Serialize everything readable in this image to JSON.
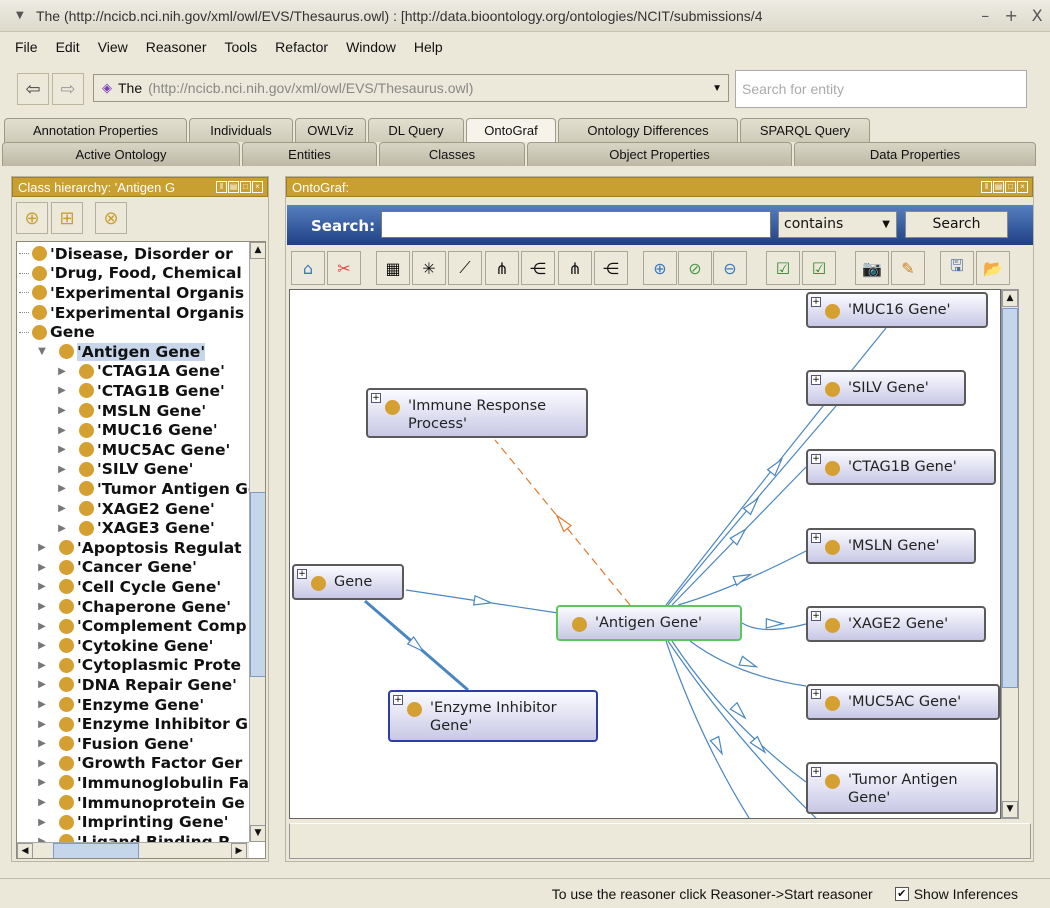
{
  "window": {
    "title": "The (http://ncicb.nci.nih.gov/xml/owl/EVS/Thesaurus.owl)  : [http://data.bioontology.org/ontologies/NCIT/submissions/4",
    "controls": [
      "–",
      "+",
      "X"
    ]
  },
  "menu": [
    "File",
    "Edit",
    "View",
    "Reasoner",
    "Tools",
    "Refactor",
    "Window",
    "Help"
  ],
  "nav": {
    "ontology_name": "The",
    "ontology_iri": "(http://ncicb.nci.nih.gov/xml/owl/EVS/Thesaurus.owl)",
    "search_placeholder": "Search for entity"
  },
  "tabs_row1": [
    {
      "label": "Annotation Properties"
    },
    {
      "label": "Individuals"
    },
    {
      "label": "OWLViz"
    },
    {
      "label": "DL Query"
    },
    {
      "label": "OntoGraf",
      "active": true
    },
    {
      "label": "Ontology Differences"
    },
    {
      "label": "SPARQL Query"
    }
  ],
  "tabs_row2": [
    {
      "label": "Active Ontology"
    },
    {
      "label": "Entities"
    },
    {
      "label": "Classes"
    },
    {
      "label": "Object Properties"
    },
    {
      "label": "Data Properties"
    }
  ],
  "left_panel": {
    "title": "Class hierarchy: 'Antigen G",
    "tree": [
      {
        "label": "'Disease, Disorder or",
        "level": 0,
        "expander": "none"
      },
      {
        "label": "'Drug, Food, Chemical",
        "level": 0,
        "expander": "none"
      },
      {
        "label": "'Experimental Organis",
        "level": 0,
        "expander": "none"
      },
      {
        "label": "'Experimental Organis",
        "level": 0,
        "expander": "none"
      },
      {
        "label": "Gene",
        "level": 0,
        "expander": "none"
      },
      {
        "label": "'Antigen Gene'",
        "level": 1,
        "expander": "expanded",
        "selected": true
      },
      {
        "label": "'CTAG1A Gene'",
        "level": 2,
        "expander": "collapsed"
      },
      {
        "label": "'CTAG1B Gene'",
        "level": 2,
        "expander": "collapsed"
      },
      {
        "label": "'MSLN Gene'",
        "level": 2,
        "expander": "collapsed"
      },
      {
        "label": "'MUC16 Gene'",
        "level": 2,
        "expander": "collapsed"
      },
      {
        "label": "'MUC5AC Gene'",
        "level": 2,
        "expander": "collapsed"
      },
      {
        "label": "'SILV Gene'",
        "level": 2,
        "expander": "collapsed"
      },
      {
        "label": "'Tumor Antigen Gene'",
        "level": 2,
        "expander": "collapsed"
      },
      {
        "label": "'XAGE2 Gene'",
        "level": 2,
        "expander": "collapsed"
      },
      {
        "label": "'XAGE3 Gene'",
        "level": 2,
        "expander": "collapsed"
      },
      {
        "label": "'Apoptosis Regulat",
        "level": 1,
        "expander": "collapsed"
      },
      {
        "label": "'Cancer Gene'",
        "level": 1,
        "expander": "collapsed"
      },
      {
        "label": "'Cell Cycle Gene'",
        "level": 1,
        "expander": "collapsed"
      },
      {
        "label": "'Chaperone Gene'",
        "level": 1,
        "expander": "collapsed"
      },
      {
        "label": "'Complement Comp",
        "level": 1,
        "expander": "collapsed"
      },
      {
        "label": "'Cytokine Gene'",
        "level": 1,
        "expander": "collapsed"
      },
      {
        "label": "'Cytoplasmic Prote",
        "level": 1,
        "expander": "collapsed"
      },
      {
        "label": "'DNA Repair Gene'",
        "level": 1,
        "expander": "collapsed"
      },
      {
        "label": "'Enzyme Gene'",
        "level": 1,
        "expander": "collapsed"
      },
      {
        "label": "'Enzyme Inhibitor G",
        "level": 1,
        "expander": "collapsed"
      },
      {
        "label": "'Fusion Gene'",
        "level": 1,
        "expander": "collapsed"
      },
      {
        "label": "'Growth Factor Ger",
        "level": 1,
        "expander": "collapsed"
      },
      {
        "label": "'Immunoglobulin Fa",
        "level": 1,
        "expander": "collapsed"
      },
      {
        "label": "'Immunoprotein Ge",
        "level": 1,
        "expander": "collapsed"
      },
      {
        "label": "'Imprinting Gene'",
        "level": 1,
        "expander": "collapsed"
      },
      {
        "label": "'Ligand Binding P",
        "level": 1,
        "expander": "collapsed"
      }
    ]
  },
  "right_panel": {
    "title": "OntoGraf:",
    "search_label": "Search:",
    "search_value": "",
    "search_mode": "contains",
    "search_button": "Search",
    "toolbar_icons": [
      "home-icon",
      "remove-unselected-icon",
      "grid-layout-icon",
      "radial-layout-icon",
      "spring-layout-icon",
      "vertical-tree-icon",
      "horizontal-tree-icon",
      "vertical-directed-tree-icon",
      "horizontal-directed-tree-icon",
      "zoom-in-icon",
      "zoom-reset-icon",
      "zoom-out-icon",
      "node-filter-icon",
      "arc-filter-icon",
      "camera-icon",
      "edit-icon",
      "save-icon",
      "open-folder-icon"
    ],
    "graph": {
      "nodes": [
        {
          "id": "immune",
          "label": "'Immune Response Process'",
          "state": "normal"
        },
        {
          "id": "gene",
          "label": "Gene",
          "state": "normal"
        },
        {
          "id": "enzinh",
          "label": "'Enzyme Inhibitor Gene'",
          "state": "highlighted"
        },
        {
          "id": "antigen",
          "label": "'Antigen Gene'",
          "state": "selected"
        },
        {
          "id": "muc16",
          "label": "'MUC16 Gene'",
          "state": "normal"
        },
        {
          "id": "silv",
          "label": "'SILV Gene'",
          "state": "normal"
        },
        {
          "id": "ctag1b",
          "label": "'CTAG1B Gene'",
          "state": "normal"
        },
        {
          "id": "msln",
          "label": "'MSLN Gene'",
          "state": "normal"
        },
        {
          "id": "xage2",
          "label": "'XAGE2 Gene'",
          "state": "normal"
        },
        {
          "id": "muc5ac",
          "label": "'MUC5AC Gene'",
          "state": "normal"
        },
        {
          "id": "tumor",
          "label": "'Tumor Antigen Gene'",
          "state": "normal"
        }
      ],
      "edges": [
        {
          "from": "gene",
          "to": "antigen",
          "type": "subclass"
        },
        {
          "from": "gene",
          "to": "enzinh",
          "type": "subclass-bold"
        },
        {
          "from": "antigen",
          "to": "immune",
          "type": "object-property"
        },
        {
          "from": "antigen",
          "to": "muc16",
          "type": "subclass"
        },
        {
          "from": "antigen",
          "to": "silv",
          "type": "subclass"
        },
        {
          "from": "antigen",
          "to": "ctag1b",
          "type": "subclass"
        },
        {
          "from": "antigen",
          "to": "msln",
          "type": "subclass"
        },
        {
          "from": "antigen",
          "to": "xage2",
          "type": "subclass"
        },
        {
          "from": "antigen",
          "to": "muc5ac",
          "type": "subclass"
        },
        {
          "from": "antigen",
          "to": "tumor",
          "type": "subclass"
        },
        {
          "from": "antigen",
          "to": "offscreen1",
          "type": "subclass"
        },
        {
          "from": "antigen",
          "to": "offscreen2",
          "type": "subclass"
        }
      ]
    }
  },
  "status": {
    "message": "To use the reasoner click Reasoner->Start reasoner",
    "show_inferences_label": "Show Inferences",
    "show_inferences_checked": true
  },
  "colors": {
    "panel_header": "#c89f31",
    "class_dot": "#d4a032",
    "subclass_edge": "#4a86c0",
    "property_edge": "#e07a30",
    "selected_node_border": "#5cc85c",
    "highlighted_node_border": "#2a3fa0",
    "search_band": "#2a4a90"
  }
}
